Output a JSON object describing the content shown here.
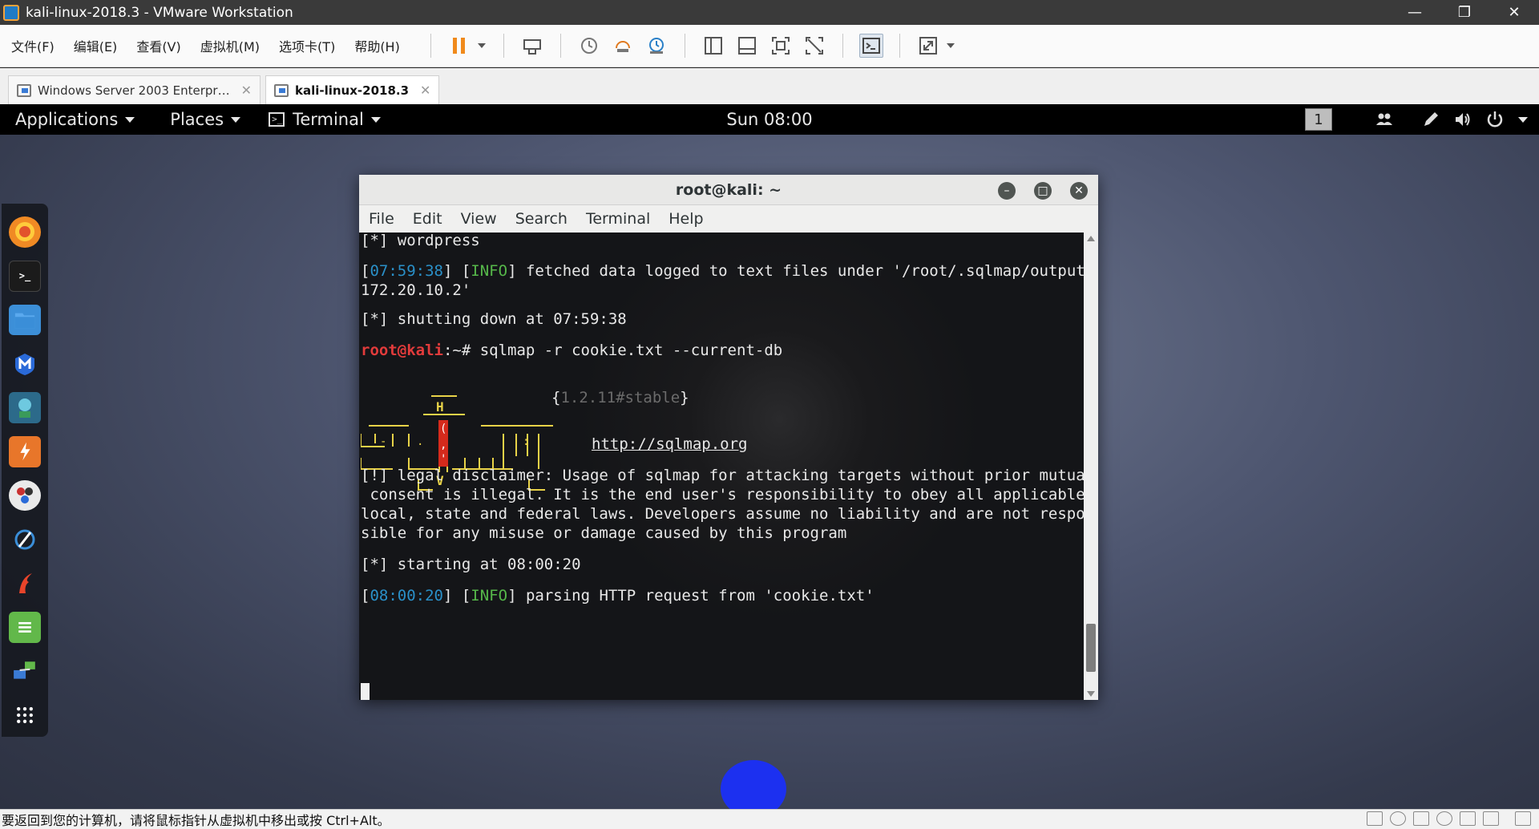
{
  "vmware": {
    "window_title": "kali-linux-2018.3 - VMware Workstation",
    "menus": [
      "文件(F)",
      "编辑(E)",
      "查看(V)",
      "虚拟机(M)",
      "选项卡(T)",
      "帮助(H)"
    ],
    "tabs": [
      {
        "label": "Windows Server 2003 Enterpr…",
        "active": false
      },
      {
        "label": "kali-linux-2018.3",
        "active": true
      }
    ],
    "status_message": "要返回到您的计算机，请将鼠标指针从虚拟机中移出或按 Ctrl+Alt。"
  },
  "gnome": {
    "applications": "Applications",
    "places": "Places",
    "terminal": "Terminal",
    "clock": "Sun 08:00",
    "workspace": "1"
  },
  "dock": {
    "items": [
      "firefox-icon",
      "terminal-icon",
      "files-icon",
      "metasploit-icon",
      "armitage-icon",
      "burpsuite-icon",
      "beef-icon",
      "faraday-icon",
      "maltego-icon",
      "leafpad-icon",
      "network-icon",
      "show-apps-icon"
    ]
  },
  "terminal": {
    "title": "root@kali: ~",
    "menu": [
      "File",
      "Edit",
      "View",
      "Search",
      "Terminal",
      "Help"
    ],
    "lines": {
      "l1": "[*] wordpress",
      "l2_time": "07:59:38",
      "l2_level": "INFO",
      "l2_msg": " fetched data logged to text files under '/root/.sqlmap/output/",
      "l3": "172.20.10.2'",
      "l4": "[*] shutting down at 07:59:38",
      "prompt_user": "root@kali",
      "prompt_rest": ":~# sqlmap -r cookie.txt --current-db",
      "version_open": "{",
      "version": "1.2.11#stable",
      "version_close": "}",
      "url": "http://sqlmap.org",
      "d1": "[!] legal disclaimer: Usage of sqlmap for attacking targets without prior mutual",
      "d2": " consent is illegal. It is the end user's responsibility to obey all applicable",
      "d3": "local, state and federal laws. Developers assume no liability and are not respon",
      "d4": "sible for any misuse or damage caused by this program",
      "start": "[*] starting at 08:00:20",
      "l_last_time": "08:00:20",
      "l_last_level": "INFO",
      "l_last_msg": " parsing HTTP request from 'cookie.txt'"
    }
  },
  "colors": {
    "timestamp": "#2a90c8",
    "info": "#56b84a",
    "prompt": "#e23b3b",
    "logo": "#e8d248"
  }
}
